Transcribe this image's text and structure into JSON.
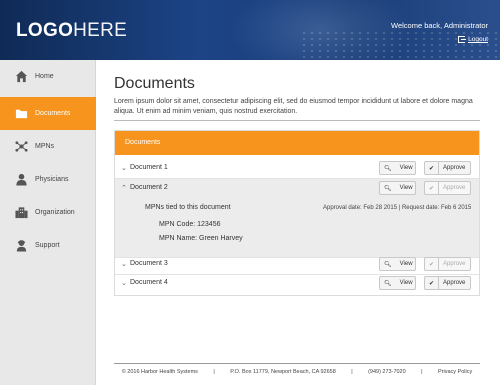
{
  "header": {
    "logo_bold": "LOGO",
    "logo_light": "HERE",
    "welcome": "Welcome back, Administrator",
    "logout": "Logout"
  },
  "sidebar": {
    "items": [
      {
        "label": "Home",
        "icon": "home-icon"
      },
      {
        "label": "Documents",
        "icon": "folder-icon",
        "active": true
      },
      {
        "label": "MPNs",
        "icon": "network-icon"
      },
      {
        "label": "Physicians",
        "icon": "person-icon"
      },
      {
        "label": "Organization",
        "icon": "building-icon"
      },
      {
        "label": "Support",
        "icon": "support-icon"
      }
    ]
  },
  "main": {
    "title": "Documents",
    "intro": "Lorem ipsum dolor sit amet, consectetur adipiscing elit, sed do eiusmod tempor incididunt ut labore et dolore magna aliqua. Ut enim ad minim veniam, quis nostrud exercitation.",
    "panel_title": "Documents",
    "view_label": "View",
    "approve_label": "Approve",
    "documents": [
      {
        "name": "Document 1",
        "expanded": false,
        "approve_enabled": true
      },
      {
        "name": "Document 2",
        "expanded": true,
        "approve_enabled": false
      },
      {
        "name": "Document 3",
        "expanded": false,
        "approve_enabled": false
      },
      {
        "name": "Document 4",
        "expanded": false,
        "approve_enabled": true
      }
    ],
    "detail": {
      "heading": "MPNs tied to this document",
      "dates": "Approval date: Feb 28 2015 | Request date: Feb 6 2015",
      "mpn_code": "MPN Code: 123456",
      "mpn_name": "MPN Name: Green Harvey"
    }
  },
  "footer": {
    "copyright": "© 2016 Harbor Health Systems",
    "address": "P.O. Box 11779, Newport Beach, CA 92658",
    "phone": "(949) 273-7020",
    "privacy": "Privacy Policy",
    "separator": "|"
  },
  "colors": {
    "accent": "#f7941d",
    "header_blue": "#1c4486"
  }
}
